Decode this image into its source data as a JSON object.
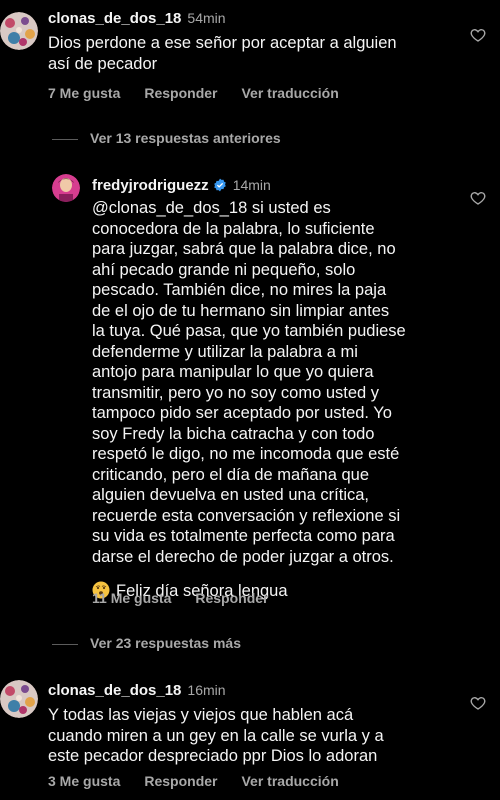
{
  "comments": [
    {
      "username": "clonas_de_dos_18",
      "time": "54min",
      "text": "Dios perdone a ese señor por aceptar a alguien\nasí de pecador",
      "likes": "7 Me gusta",
      "reply": "Responder",
      "translate": "Ver traducción"
    },
    {
      "username": "fredyjrodriguezz",
      "time": "14min",
      "text": "@clonas_de_dos_18 si usted es\nconocedora de la palabra, lo suficiente\npara juzgar, sabrá que la palabra dice, no\nahí pecado grande ni pequeño, solo\npescado. También dice, no mires la paja\nde el ojo de tu hermano sin limpiar antes\nla tuya. Qué pasa, que yo también pudiese\ndefenderme y utilizar la palabra a mi\nantojo para manipular lo que yo quiera\ntransmitir, pero yo no soy como usted y\ntampoco pido ser aceptado por usted. Yo\nsoy Fredy la bicha catracha y con todo\nrespetó le digo, no me incomoda que esté\ncriticando, pero el día de mañana que\nalguien devuelva en usted una crítica,\nrecuerde esta conversación y reflexione si\nsu vida es totalmente perfecta como para\ndarse el derecho de poder juzgar a otros.",
      "last_line": "Feliz día señora lengua",
      "likes": "11 Me gusta",
      "reply": "Responder"
    },
    {
      "username": "clonas_de_dos_18",
      "time": "16min",
      "text": "Y todas las viejas y viejos que hablen acá\ncuando miren a un gey en la calle se vurla y a\neste pecador  despreciado ppr Dios lo adoran",
      "likes": "3 Me gusta",
      "reply": "Responder",
      "translate": "Ver traducción"
    }
  ],
  "view_previous": "Ver 13 respuestas anteriores",
  "view_more": "Ver 23 respuestas más",
  "icons": {
    "like": "heart-outline-icon",
    "verified": "verified-badge-icon",
    "emoji": "hushed-face-emoji"
  },
  "colors": {
    "background": "#000000",
    "text": "#f5f5f5",
    "muted": "#a8a8a8",
    "verified": "#3797f0"
  }
}
